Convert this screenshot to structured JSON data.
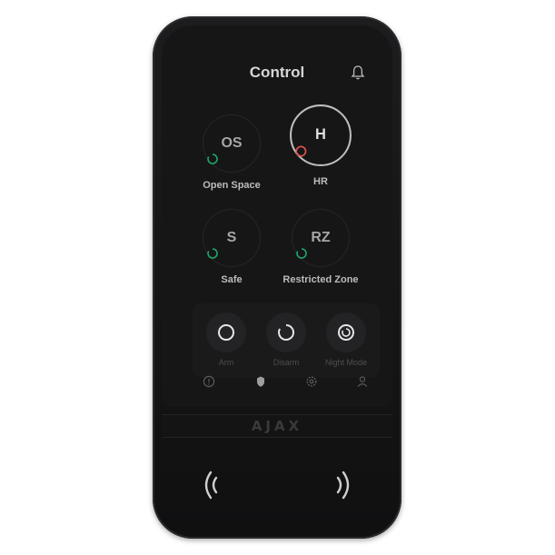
{
  "header": {
    "title": "Control"
  },
  "zones": [
    {
      "short": "OS",
      "label": "Open Space",
      "status": "disarmed",
      "status_color": "#1fa86b",
      "active": false
    },
    {
      "short": "H",
      "label": "HR",
      "status": "armed",
      "status_color": "#e0524b",
      "active": true
    },
    {
      "short": "S",
      "label": "Safe",
      "status": "disarmed",
      "status_color": "#1fa86b",
      "active": false
    },
    {
      "short": "RZ",
      "label": "Restricted Zone",
      "status": "disarmed",
      "status_color": "#1fa86b",
      "active": false
    }
  ],
  "modes": [
    {
      "label": "Arm",
      "icon": "ring-icon"
    },
    {
      "label": "Disarm",
      "icon": "open-ring-icon"
    },
    {
      "label": "Night Mode",
      "icon": "night-mode-icon"
    }
  ],
  "tabs": [
    {
      "icon": "alarm-icon"
    },
    {
      "icon": "shield-icon"
    },
    {
      "icon": "gear-icon"
    },
    {
      "icon": "user-icon"
    }
  ],
  "brand": {
    "logo": "AJAX"
  },
  "colors": {
    "body": "#151516",
    "armed": "#e0524b",
    "disarmed": "#1fa86b",
    "text": "#d6d6d6"
  }
}
